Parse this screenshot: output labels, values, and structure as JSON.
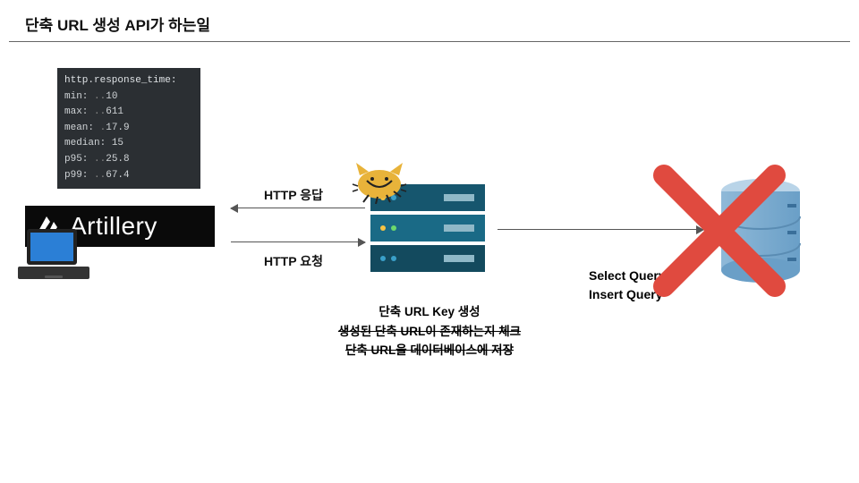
{
  "title": "단축 URL 생성 API가 하는일",
  "terminal": {
    "header": "http.response_time:",
    "rows": [
      {
        "label": "min:",
        "value": "10"
      },
      {
        "label": "max:",
        "value": "611"
      },
      {
        "label": "mean:",
        "value": "17.9"
      },
      {
        "label": "median:",
        "value": "15"
      },
      {
        "label": "p95:",
        "value": "25.8"
      },
      {
        "label": "p99:",
        "value": "67.4"
      }
    ]
  },
  "artillery_label": "Artillery",
  "arrows": {
    "response_label": "HTTP 응답",
    "request_label": "HTTP 요청"
  },
  "server_caption": {
    "line1": "단축 URL Key 생성",
    "line2_struck": "생성된 단축 URL이 존재하는지 체크",
    "line3_struck": "단축 URL을 데이터베이스에 저장"
  },
  "query_caption": {
    "line1": "Select Query",
    "line2": "Insert Query"
  },
  "icons": {
    "artillery": "artillery-logo-icon",
    "laptop": "laptop-icon",
    "server": "server-stack-icon",
    "tomcat": "tomcat-icon",
    "database": "database-icon",
    "redx": "red-x-icon"
  }
}
